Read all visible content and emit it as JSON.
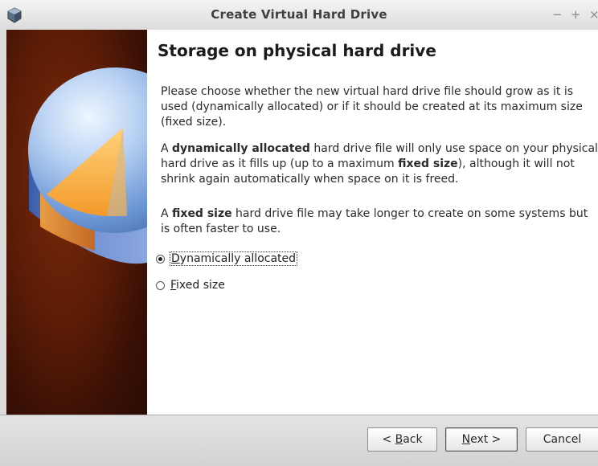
{
  "window": {
    "title": "Create Virtual Hard Drive",
    "icon": "virtualbox-cube-icon",
    "controls": {
      "minimize": "−",
      "maximize": "+",
      "close": "×"
    }
  },
  "banner": {
    "image": "hard-drive-illustration"
  },
  "page": {
    "heading": "Storage on physical hard drive",
    "p1": "Please choose whether the new virtual hard drive file should grow as it is used (dynamically allocated) or if it should be created at its maximum size (fixed size).",
    "p2": {
      "a": "A ",
      "b1": "dynamically allocated",
      "c": " hard drive file will only use space on your physical hard drive as it fills up (up to a maximum ",
      "b2": "fixed size",
      "d": "), although it will not shrink again automatically when space on it is freed."
    },
    "p3": {
      "a": "A ",
      "b1": "fixed size",
      "c": " hard drive file may take longer to create on some systems but is often faster to use."
    }
  },
  "options": {
    "dynamic": {
      "mnemonic": "D",
      "rest": "ynamically allocated",
      "checked": true
    },
    "fixed": {
      "mnemonic": "F",
      "rest": "ixed size",
      "checked": false
    }
  },
  "buttons": {
    "back": {
      "pre": "< ",
      "mnemonic": "B",
      "rest": "ack"
    },
    "next": {
      "mnemonic": "N",
      "rest": "ext >"
    },
    "cancel": "Cancel"
  }
}
